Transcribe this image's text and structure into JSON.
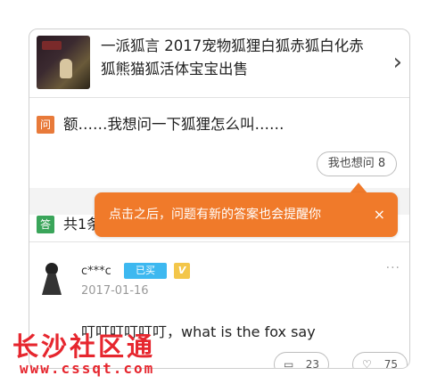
{
  "product": {
    "title": "一派狐言 2017宠物狐狸白狐赤狐白化赤狐熊猫狐活体宝宝出售",
    "chevron_icon": "chevron-right-icon"
  },
  "question": {
    "badge": "问",
    "text": "额……我想问一下狐狸怎么叫……",
    "ask_button": "我也想问 8"
  },
  "answers": {
    "badge": "答",
    "count_text": "共1条"
  },
  "tooltip": {
    "text": "点击之后，问题有新的答案也会提醒你",
    "close": "×"
  },
  "answer": {
    "user": "c***c",
    "tag": "已买",
    "vip": "V",
    "more": "···",
    "date": "2017-01-16",
    "text": "叮叮叮叮叮叮，what is the fox say",
    "comments": "23",
    "likes": "75"
  },
  "watermark": {
    "title": "长沙社区通",
    "url": "www.cssqt.com"
  },
  "colors": {
    "question_badge": "#e87a3a",
    "answer_badge": "#3aa55a",
    "tooltip": "#f07a2a",
    "tag_bought": "#3db8f0",
    "tag_vip": "#f3c64a",
    "watermark": "#e6262e"
  }
}
